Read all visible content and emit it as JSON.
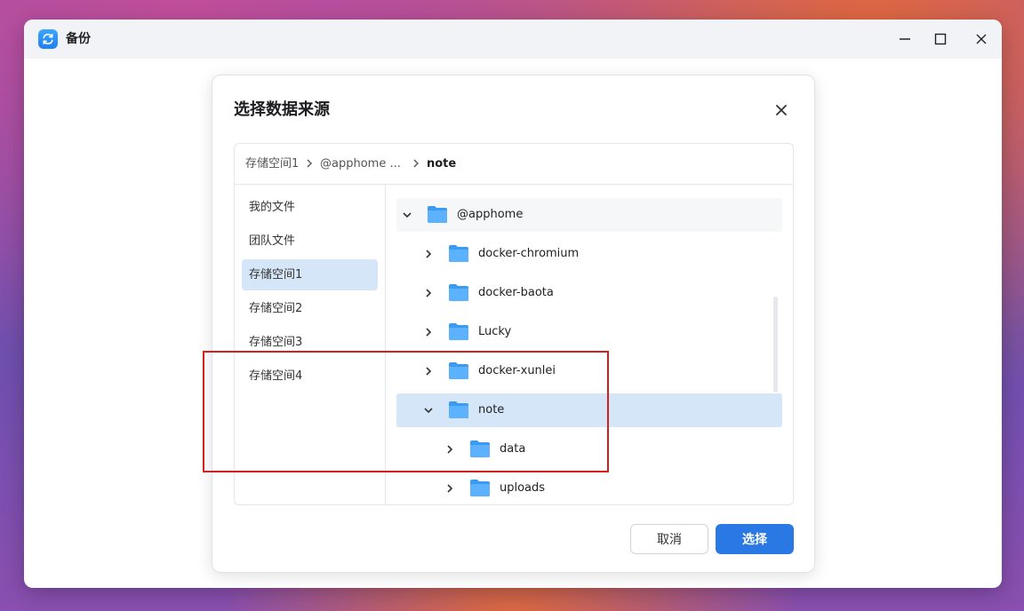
{
  "window": {
    "title": "备份",
    "app_icon": "sync-icon"
  },
  "dialog": {
    "title": "选择数据来源",
    "breadcrumb": [
      "存储空间1",
      "@apphome ...",
      "note"
    ],
    "sidebar": {
      "items": [
        {
          "label": "我的文件"
        },
        {
          "label": "团队文件"
        },
        {
          "label": "存储空间1",
          "active": true
        },
        {
          "label": "存储空间2"
        },
        {
          "label": "存储空间3"
        },
        {
          "label": "存储空间4"
        }
      ]
    },
    "tree": {
      "rows": [
        {
          "label": "@apphome",
          "expanded": true,
          "level": 0
        },
        {
          "label": "docker-chromium",
          "expanded": false,
          "level": 1
        },
        {
          "label": "docker-baota",
          "expanded": false,
          "level": 1
        },
        {
          "label": "Lucky",
          "expanded": false,
          "level": 1
        },
        {
          "label": "docker-xunlei",
          "expanded": false,
          "level": 1
        },
        {
          "label": "note",
          "expanded": true,
          "level": 1,
          "selected": true
        },
        {
          "label": "data",
          "expanded": false,
          "level": 2
        },
        {
          "label": "uploads",
          "expanded": false,
          "level": 2
        }
      ]
    },
    "buttons": {
      "cancel": "取消",
      "select": "选择"
    }
  },
  "colors": {
    "accent": "#2a78e4",
    "selected_bg": "#d6e6f9",
    "highlight": "#d3201f"
  }
}
